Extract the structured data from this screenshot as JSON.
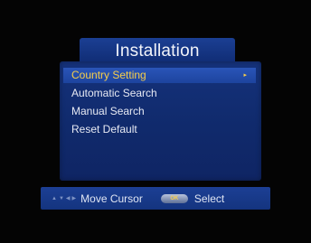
{
  "menu": {
    "title": "Installation",
    "items": [
      {
        "label": "Country Setting",
        "selected": true,
        "arrow": "▸"
      },
      {
        "label": "Automatic Search",
        "selected": false
      },
      {
        "label": "Manual Search",
        "selected": false
      },
      {
        "label": "Reset Default",
        "selected": false
      }
    ]
  },
  "help_bar": {
    "direction_icons": [
      "▲",
      "▼",
      "◀",
      "▶"
    ],
    "move_label": "Move Cursor",
    "ok_button": "OK",
    "select_label": "Select"
  },
  "colors": {
    "panel": "#13307a",
    "selected_text": "#f7ce4a",
    "text": "#e6e9f3",
    "background": "#050505"
  }
}
